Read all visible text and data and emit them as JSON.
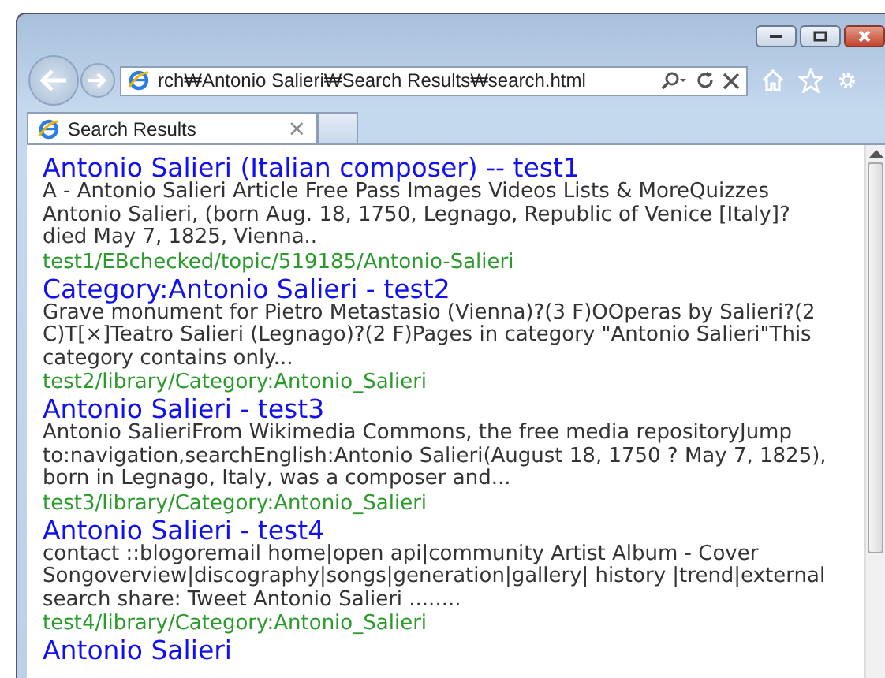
{
  "address": {
    "value": "rch₩Antonio Salieri₩Search Results₩search.html"
  },
  "tabs": [
    {
      "title": "Search Results",
      "close": "×",
      "selected": true
    }
  ],
  "results": [
    {
      "title": "Antonio Salieri (Italian composer) -- test1",
      "snippet": "A - Antonio Salieri Article Free Pass Images Videos Lists & MoreQuizzes Antonio Salieri, (born Aug. 18, 1750, Legnago, Republic of Venice [Italy]? died May 7, 1825, Vienna..",
      "url": "test1/EBchecked/topic/519185/Antonio-Salieri"
    },
    {
      "title": "Category:Antonio Salieri - test2",
      "snippet": "Grave monument for Pietro Metastasio (Vienna)?(3 F)OOperas by Salieri?(2 C)T[×]Teatro Salieri (Legnago)?(2 F)Pages in category \"Antonio Salieri\"This category contains only...",
      "url": "test2/library/Category:Antonio_Salieri"
    },
    {
      "title": "Antonio Salieri - test3",
      "snippet": "Antonio SalieriFrom Wikimedia Commons, the free media repositoryJump to:navigation,searchEnglish:Antonio Salieri(August 18, 1750 ? May 7, 1825), born in Legnago, Italy, was a composer and...",
      "url": "test3/library/Category:Antonio_Salieri"
    },
    {
      "title": "Antonio Salieri - test4",
      "snippet": "contact ::blogoremail home|open api|community Artist Album - Cover Songoverview|discography|songs|generation|gallery| history |trend|external search share: Tweet Antonio Salieri ........",
      "url": "test4/library/Category:Antonio_Salieri"
    },
    {
      "title": "Antonio Salieri"
    }
  ]
}
